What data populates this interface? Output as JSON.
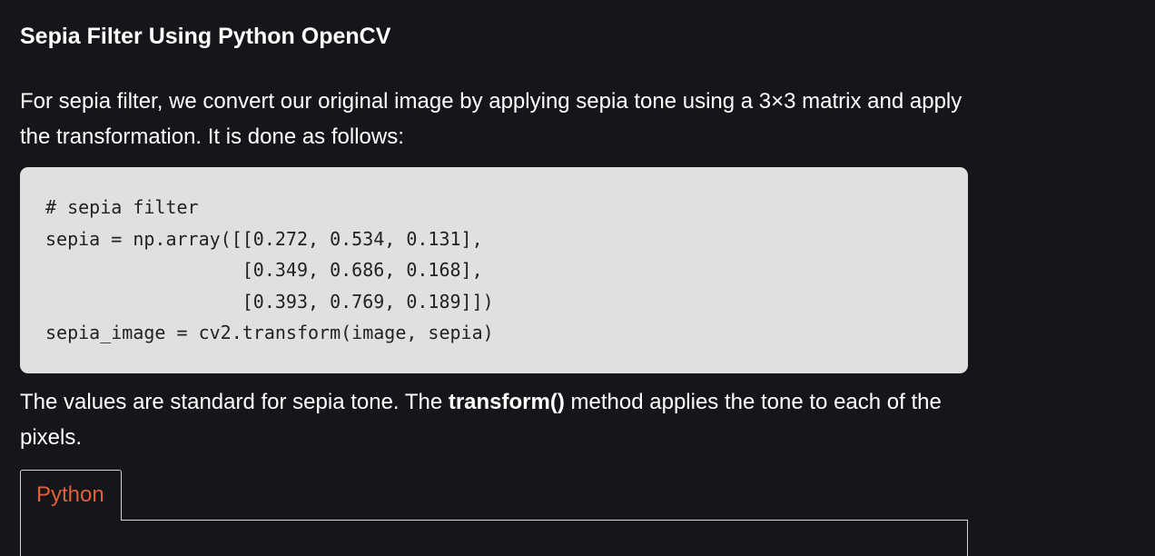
{
  "heading": "Sepia Filter Using Python OpenCV",
  "intro_paragraph": "For sepia filter, we convert our original image by applying sepia tone using a 3×3 matrix and apply the transformation. It is done as follows:",
  "code": {
    "lines": [
      "# sepia filter",
      "sepia = np.array([[0.272, 0.534, 0.131],",
      "                  [0.349, 0.686, 0.168],",
      "                  [0.393, 0.769, 0.189]])",
      "sepia_image = cv2.transform(image, sepia)"
    ]
  },
  "explanation": {
    "before": "The values are standard for sepia tone. The ",
    "bold": "transform()",
    "after": " method applies the tone to each of the pixels."
  },
  "tabs": {
    "items": [
      "Python"
    ],
    "active_color": "#e0603a"
  },
  "colors": {
    "background": "#151619",
    "code_background": "#e0e0e0",
    "text": "#ffffff"
  }
}
